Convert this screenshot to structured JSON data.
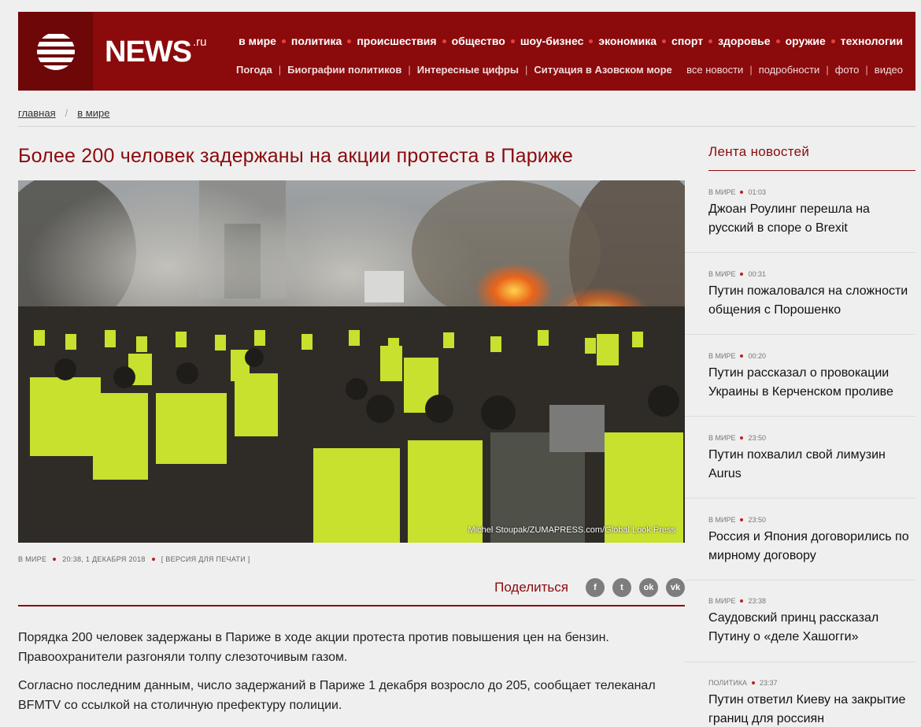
{
  "header": {
    "logo": "NEWS",
    "logo_domain": ".ru",
    "nav_main": [
      "в мире",
      "политика",
      "происшествия",
      "общество",
      "шоу-бизнес",
      "экономика",
      "спорт",
      "здоровье",
      "оружие",
      "технологии"
    ],
    "nav_topics": [
      "Погода",
      "Биографии политиков",
      "Интересные цифры",
      "Ситуация в Азовском море"
    ],
    "nav_sections": [
      "все новости",
      "подробности",
      "фото",
      "видео"
    ]
  },
  "breadcrumb": [
    "главная",
    "в мире"
  ],
  "article": {
    "title": "Более 200 человек задержаны на акции протеста в Париже",
    "photo_credit": "Michel Stoupak/ZUMAPRESS.com/Global Look Press",
    "rubric": "В МИРЕ",
    "datetime": "20:38, 1 ДЕКАБРЯ 2018",
    "print_version": "[ ВЕРСИЯ ДЛЯ ПЕЧАТИ ]",
    "share_label": "Поделиться",
    "share_buttons": [
      {
        "icon": "facebook-icon",
        "glyph": "f"
      },
      {
        "icon": "twitter-icon",
        "glyph": "t"
      },
      {
        "icon": "odnoklassniki-icon",
        "glyph": "ok"
      },
      {
        "icon": "vk-icon",
        "glyph": "vk"
      }
    ],
    "paragraphs": [
      "Порядка 200 человек задержаны в Париже в ходе акции протеста против повышения цен на бензин. Правоохранители разгоняли толпу слезоточивым газом.",
      "Согласно последним данным, число задержаний в Париже 1 декабря возросло до 205, сообщает телеканал BFMTV со ссылкой на столичную префектуру полиции."
    ]
  },
  "feed": {
    "title": "Лента новостей",
    "items": [
      {
        "rubric": "в мире",
        "time": "01:03",
        "text": "Джоан Роулинг перешла на русский в споре о Brexit"
      },
      {
        "rubric": "в мире",
        "time": "00:31",
        "text": "Путин пожаловался на сложности общения с Порошенко"
      },
      {
        "rubric": "в мире",
        "time": "00:20",
        "text": "Путин рассказал о провокации Украины в Керченском проливе"
      },
      {
        "rubric": "в мире",
        "time": "23:50",
        "text": "Путин похвалил свой лимузин Aurus"
      },
      {
        "rubric": "в мире",
        "time": "23:50",
        "text": "Россия и Япония договорились по мирному договору"
      },
      {
        "rubric": "в мире",
        "time": "23:38",
        "text": "Саудовский принц рассказал Путину о «деле Хашогги»"
      },
      {
        "rubric": "политика",
        "time": "23:37",
        "text": "Путин ответил Киеву на закрытие границ для россиян"
      }
    ]
  },
  "colors": {
    "brand": "#8b0a0c",
    "brand_dark": "#6e0708",
    "accent_dot": "#e7403f",
    "share_icon": "#7d7d7d"
  }
}
